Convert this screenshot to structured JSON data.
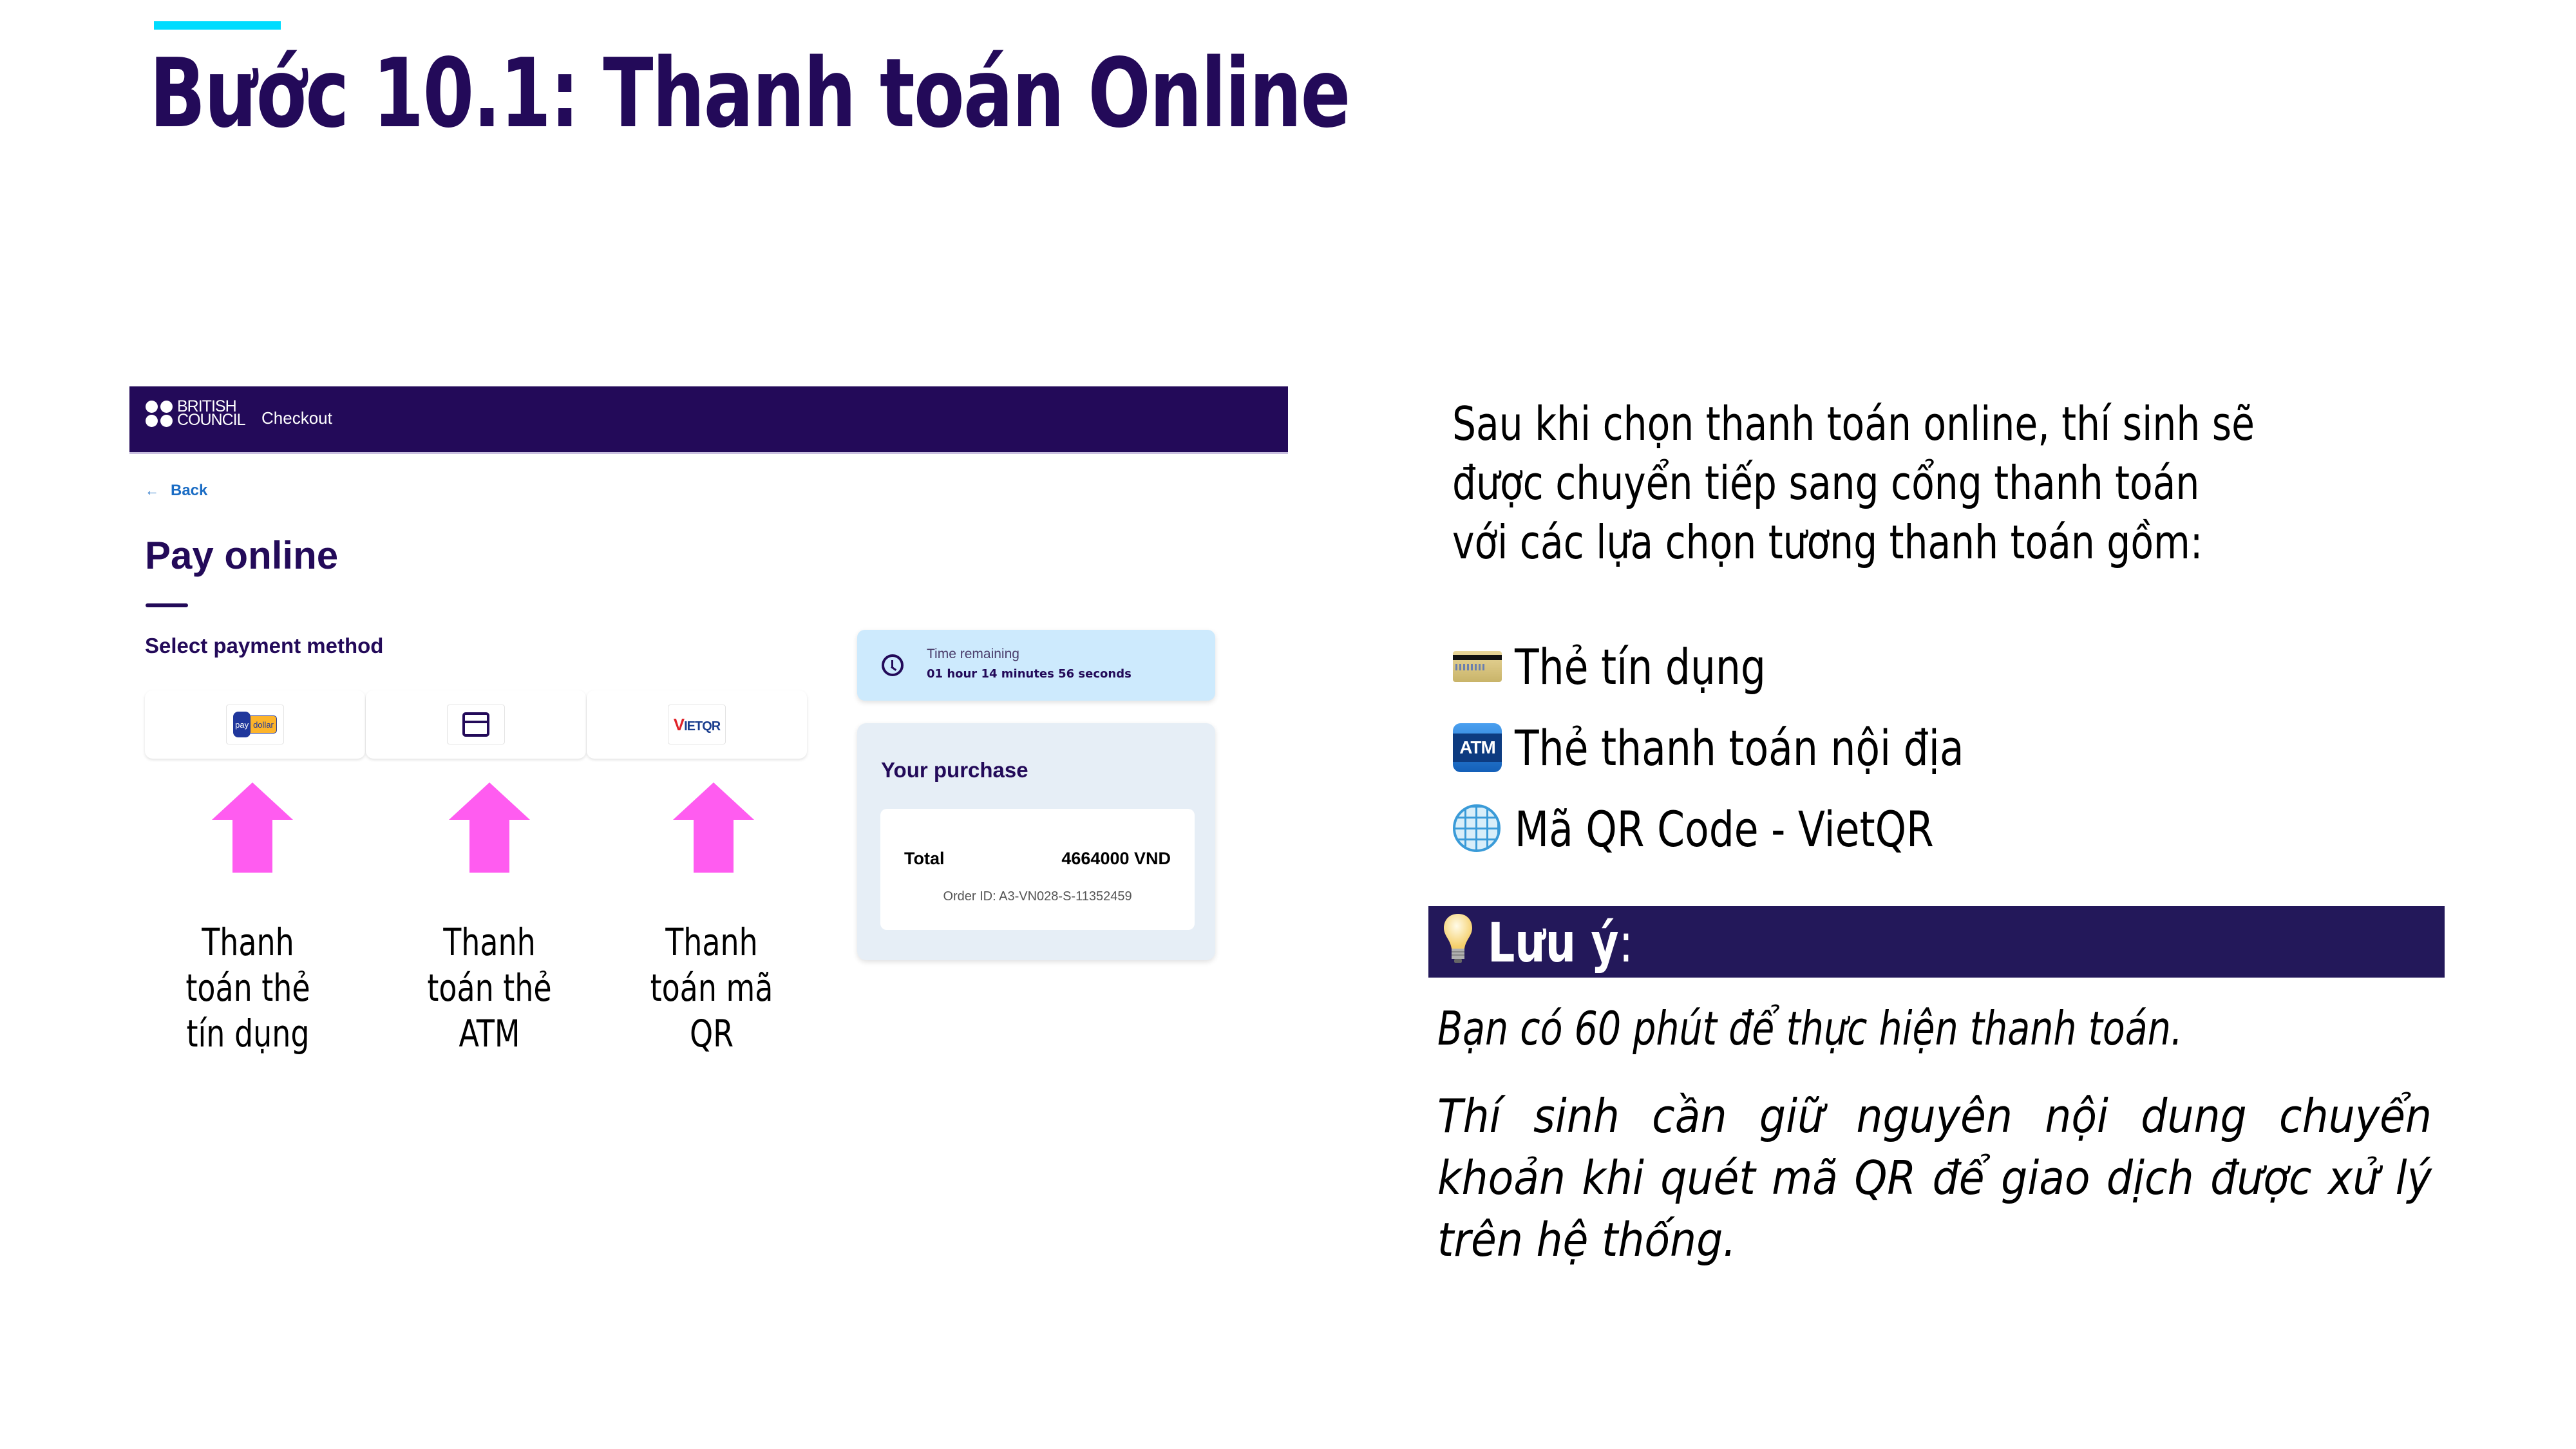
{
  "slide": {
    "title_bold": "Bước 10.1:",
    "title_regular": " Thanh toán Online",
    "accent_color": "#00dcff",
    "brand_color": "#230a59"
  },
  "checkout": {
    "logo_line1": "BRITISH",
    "logo_line2": "COUNCIL",
    "header_title": "Checkout",
    "back_label": "Back",
    "back_icon": "arrow-left-icon",
    "page_title": "Pay online",
    "section_label": "Select payment method",
    "methods": [
      {
        "name": "paydollar",
        "logo_parts": [
          "pay",
          "dollar"
        ]
      },
      {
        "name": "card",
        "icon": "credit-card-icon"
      },
      {
        "name": "vietqr",
        "logo_parts": [
          "V",
          "IETQR"
        ]
      }
    ],
    "timer": {
      "icon": "clock-icon",
      "label": "Time remaining",
      "value": "01 hour 14 minutes 56 seconds"
    },
    "purchase": {
      "title": "Your purchase",
      "total_label": "Total",
      "total_value": "4664000 VND",
      "order_id": "Order ID: A3-VN028-S-11352459"
    }
  },
  "annotations": {
    "arrow_color": "#ff5cf0",
    "labels": [
      "Thanh toán thẻ tín dụng",
      "Thanh toán thẻ ATM",
      "Thanh toán mã QR"
    ]
  },
  "explanation": {
    "intro_lines": [
      "Sau khi chọn thanh toán online, thí sinh sẽ",
      "được chuyển tiếp sang cổng thanh toán",
      "với các lựa chọn tương thanh toán gồm:"
    ],
    "options": [
      {
        "icon": "credit-card-icon",
        "label": "Thẻ tín dụng"
      },
      {
        "icon": "atm-icon",
        "icon_text": "ATM",
        "label": "Thẻ thanh toán nội địa"
      },
      {
        "icon": "globe-icon",
        "label": "Mã QR Code - VietQR"
      }
    ]
  },
  "note": {
    "icon": "light-bulb-icon",
    "title": "Lưu ý",
    "colon": ":",
    "paragraph1": "Bạn có 60 phút để thực hiện thanh toán.",
    "paragraph2": "Thí sinh cần giữ nguyên nội dung chuyển khoản khi quét mã QR để giao dịch được xử lý trên hệ thống."
  }
}
